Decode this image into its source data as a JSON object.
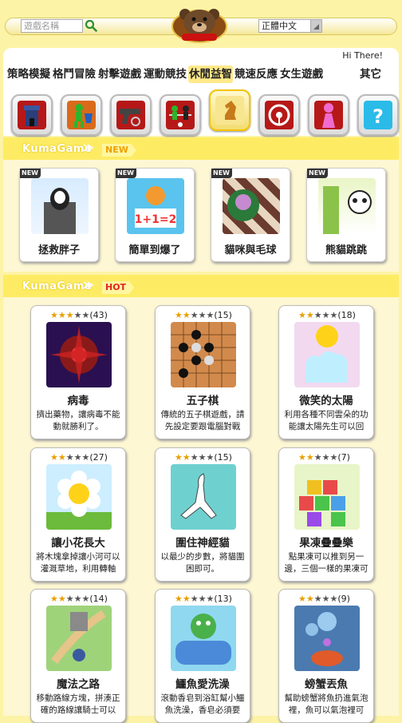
{
  "header": {
    "search_placeholder": "遊戲名稱",
    "language": "正體中文",
    "greeting": "Hi There!"
  },
  "categories": [
    "策略模擬",
    "格鬥冒險",
    "射擊遊戲",
    "運動競技",
    "休閒益智",
    "競速反應",
    "女生遊戲",
    "其它"
  ],
  "category_icons": [
    "castle-icon",
    "fighter-icon",
    "pistol-icon",
    "foosball-icon",
    "chess-knight-icon",
    "steering-wheel-icon",
    "girl-icon",
    "question-block-icon"
  ],
  "new_section": {
    "brand": "KumaGame",
    "chev": "≫",
    "tag": "NEW",
    "badge": "NEW",
    "games": [
      "拯救胖子",
      "簡單到爆了",
      "貓咪與毛球",
      "熊貓跳跳"
    ]
  },
  "hot_section": {
    "brand": "KumaGame",
    "chev": "≫",
    "tag": "HOT",
    "games": [
      {
        "title": "病毒",
        "rating": 3,
        "count": "(43)",
        "desc": "擠出藥物，讓病毒不能動就勝利了。"
      },
      {
        "title": "五子棋",
        "rating": 2,
        "count": "(15)",
        "desc": "傳統的五子棋遊戲，請先設定要跟電腦對戰或..."
      },
      {
        "title": "微笑的太陽",
        "rating": 2,
        "count": "(18)",
        "desc": "利用各種不同雲朵的功能讓太陽先生可以回到..."
      },
      {
        "title": "讓小花長大",
        "rating": 2,
        "count": "(27)",
        "desc": "將木塊拿掉讓小河可以灌溉草地，利用轉軸開..."
      },
      {
        "title": "圍住神經貓",
        "rating": 2,
        "count": "(15)",
        "desc": "以最少的步數，將貓圍困即可。"
      },
      {
        "title": "果凍疊疊樂",
        "rating": 2,
        "count": "(7)",
        "desc": "點果凍可以推到另一邊，三個一樣的果凍可以..."
      },
      {
        "title": "魔法之路",
        "rating": 2,
        "count": "(14)",
        "desc": "移動路線方塊，拼湊正確的路線讓騎士可以成..."
      },
      {
        "title": "鱷魚愛洗澡",
        "rating": 2,
        "count": "(13)",
        "desc": "滾動香皂到浴缸幫小鱷魚洗澡，香皂必須要直..."
      },
      {
        "title": "螃蟹丟魚",
        "rating": 2,
        "count": "(9)",
        "desc": "幫助螃蟹將魚扔進氣泡裡，魚可以氣泡裡可以..."
      }
    ]
  },
  "colors": {
    "accent": "#fdec63",
    "hot_tag": "#ff2b2b",
    "new_tag": "#fff6a0",
    "page_bg": "#fef7d3"
  }
}
